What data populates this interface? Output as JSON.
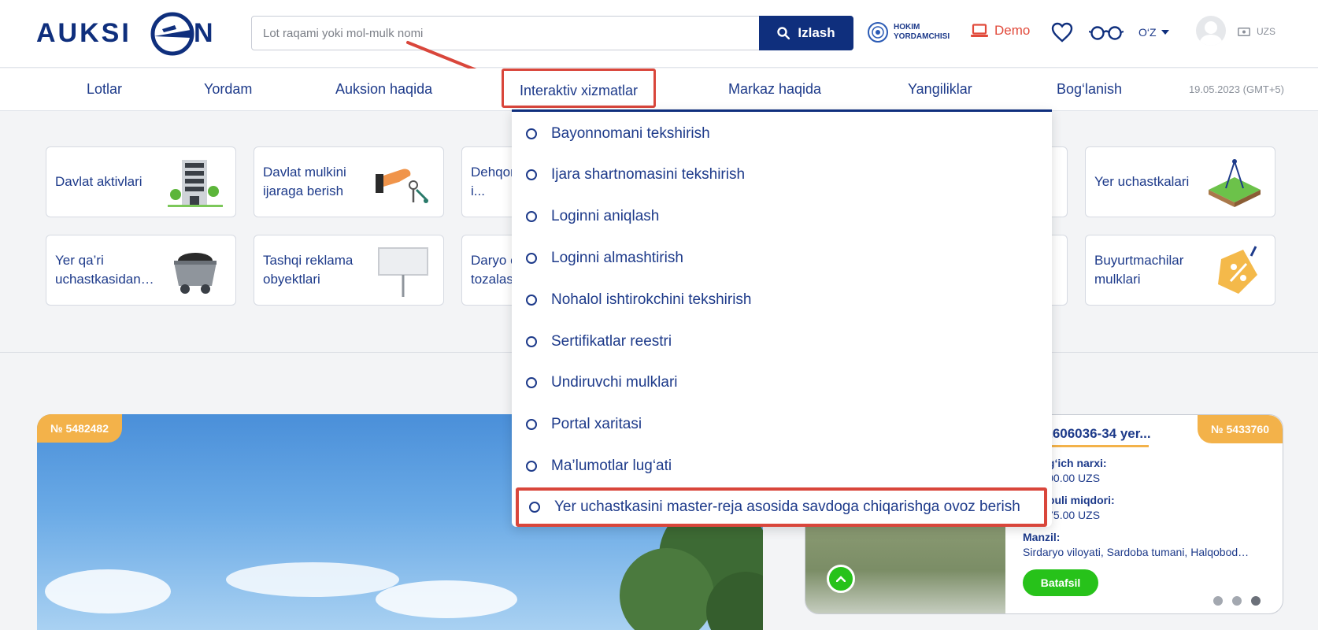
{
  "header": {
    "logo_text": "AUKSION",
    "logo_small": "E-AUKSION",
    "search_placeholder": "Lot raqami yoki mol-mulk nomi",
    "search_button": "Izlash",
    "hokim_line1": "HOKIM",
    "hokim_line2": "YORDAMCHISI",
    "demo_label": "Demo",
    "language": "O‘Z",
    "currency": "UZS"
  },
  "nav": {
    "items": [
      {
        "label": "Lotlar"
      },
      {
        "label": "Yordam"
      },
      {
        "label": "Auksion haqida"
      },
      {
        "label": "Interaktiv xizmatlar"
      },
      {
        "label": "Markaz haqida"
      },
      {
        "label": "Yangiliklar"
      },
      {
        "label": "Bog‘lanish"
      }
    ],
    "date": "19.05.2023 (GMT+5)"
  },
  "categories": [
    {
      "label": "Davlat aktivlari"
    },
    {
      "label": "Davlat mulkini ijaraga berish"
    },
    {
      "label": "Dehqon... yerlar i..."
    },
    {
      "label": "Yer uchastkalari"
    },
    {
      "label": "Yer qa’ri uchastkasidan…"
    },
    {
      "label": "Tashqi reklama obyektlari"
    },
    {
      "label": "Daryo o... tozalas..."
    },
    {
      "label": "Buyurtmachilar mulklari"
    }
  ],
  "dropdown": {
    "items": [
      "Bayonnomani tekshirish",
      "Ijara shartnomasini tekshirish",
      "Loginni aniqlash",
      "Loginni almashtirish",
      "Nohalol ishtirokchini tekshirish",
      "Sertifikatlar reestri",
      "Undiruvchi mulklari",
      "Portal xaritasi",
      "Ma’lumotlar lug‘ati",
      "Yer uchastkasini master-reja asosida savdoga chiqarishga ovoz berish"
    ]
  },
  "lots": {
    "big_badge": "№ 5482482",
    "small_badge": "№ 5433760",
    "small_title": "2422606036-34 yer...",
    "start_price_label": "...lang‘ich narxi:",
    "start_price_value": "...2 200.00 UZS",
    "deposit_label": "...lat puli miqdori:",
    "deposit_value": "...0 275.00 UZS",
    "address_label": "Manzil:",
    "address_value": "Sirdaryo viloyati, Sardoba tumani, Halqobod…",
    "more_button": "Batafsil"
  },
  "colors": {
    "brand_navy": "#0f2f7d",
    "link_blue": "#1d3a8a",
    "highlight_red": "#d9463b",
    "badge_orange": "#f3b24a",
    "action_green": "#27c21a"
  }
}
